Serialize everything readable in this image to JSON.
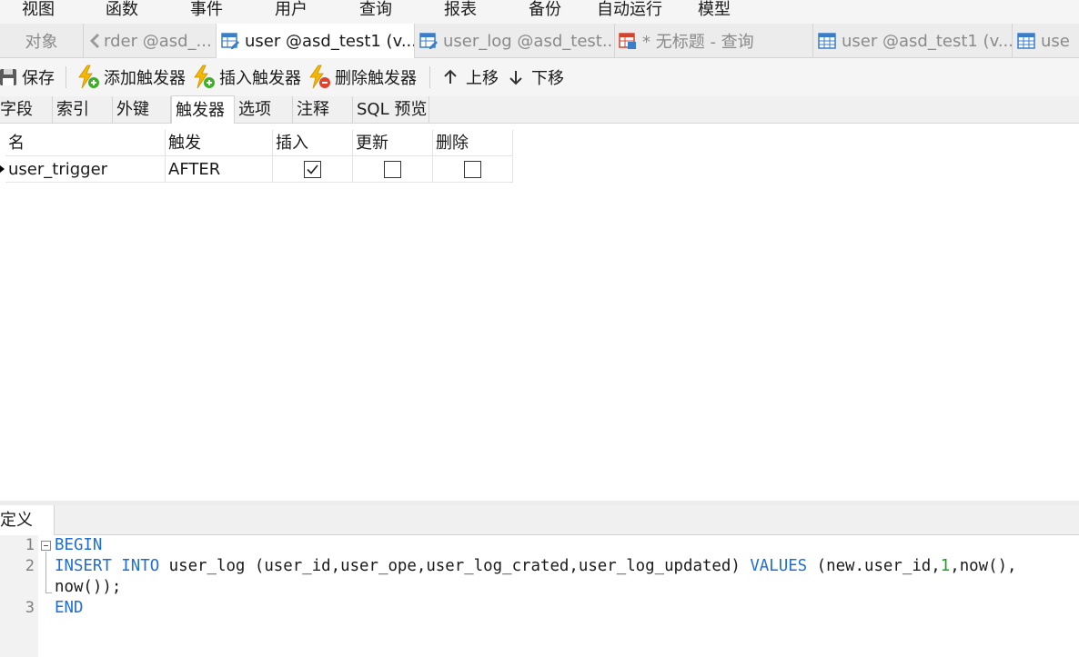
{
  "menu": [
    "视图",
    "函数",
    "事件",
    "用户",
    "查询",
    "报表",
    "备份",
    "自动运行",
    "模型"
  ],
  "tabs": {
    "objects": "对象",
    "order": "rder @asd_...",
    "user_active": "user @asd_test1 (v...",
    "user_log": "user_log @asd_test...",
    "untitled": "* 无标题 - 查询",
    "user2": "user @asd_test1 (v...",
    "user3": "use"
  },
  "toolbar": {
    "save": "保存",
    "add_trigger": "添加触发器",
    "insert_trigger": "插入触发器",
    "delete_trigger": "删除触发器",
    "move_up": "上移",
    "move_down": "下移"
  },
  "subtabs": [
    "字段",
    "索引",
    "外键",
    "触发器",
    "选项",
    "注释",
    "SQL 预览"
  ],
  "grid": {
    "headers": [
      "名",
      "触发",
      "插入",
      "更新",
      "删除"
    ],
    "rows": [
      {
        "name": "user_trigger",
        "timing": "AFTER",
        "insert": true,
        "update": false,
        "delete": false
      }
    ]
  },
  "definition": {
    "tab_label": "定义",
    "line_numbers": [
      "1",
      "2",
      "3"
    ],
    "code": {
      "begin": "BEGIN",
      "insert_kw": "INSERT INTO",
      "table": " user_log (user_id,user_ope,user_log_crated,user_log_updated) ",
      "values_kw": "VALUES",
      "values_pre": " (new.user_id,",
      "values_num": "1",
      "values_post": ",now(),",
      "wrap": "now());",
      "end": "END"
    }
  },
  "colors": {
    "keyword": "#1f6ed4",
    "number": "#19a31b",
    "trigger_icon": "#f5b800",
    "add_badge": "#3fae2a",
    "delete_badge": "#e0442e",
    "table_icon": "#3a7dc9"
  }
}
